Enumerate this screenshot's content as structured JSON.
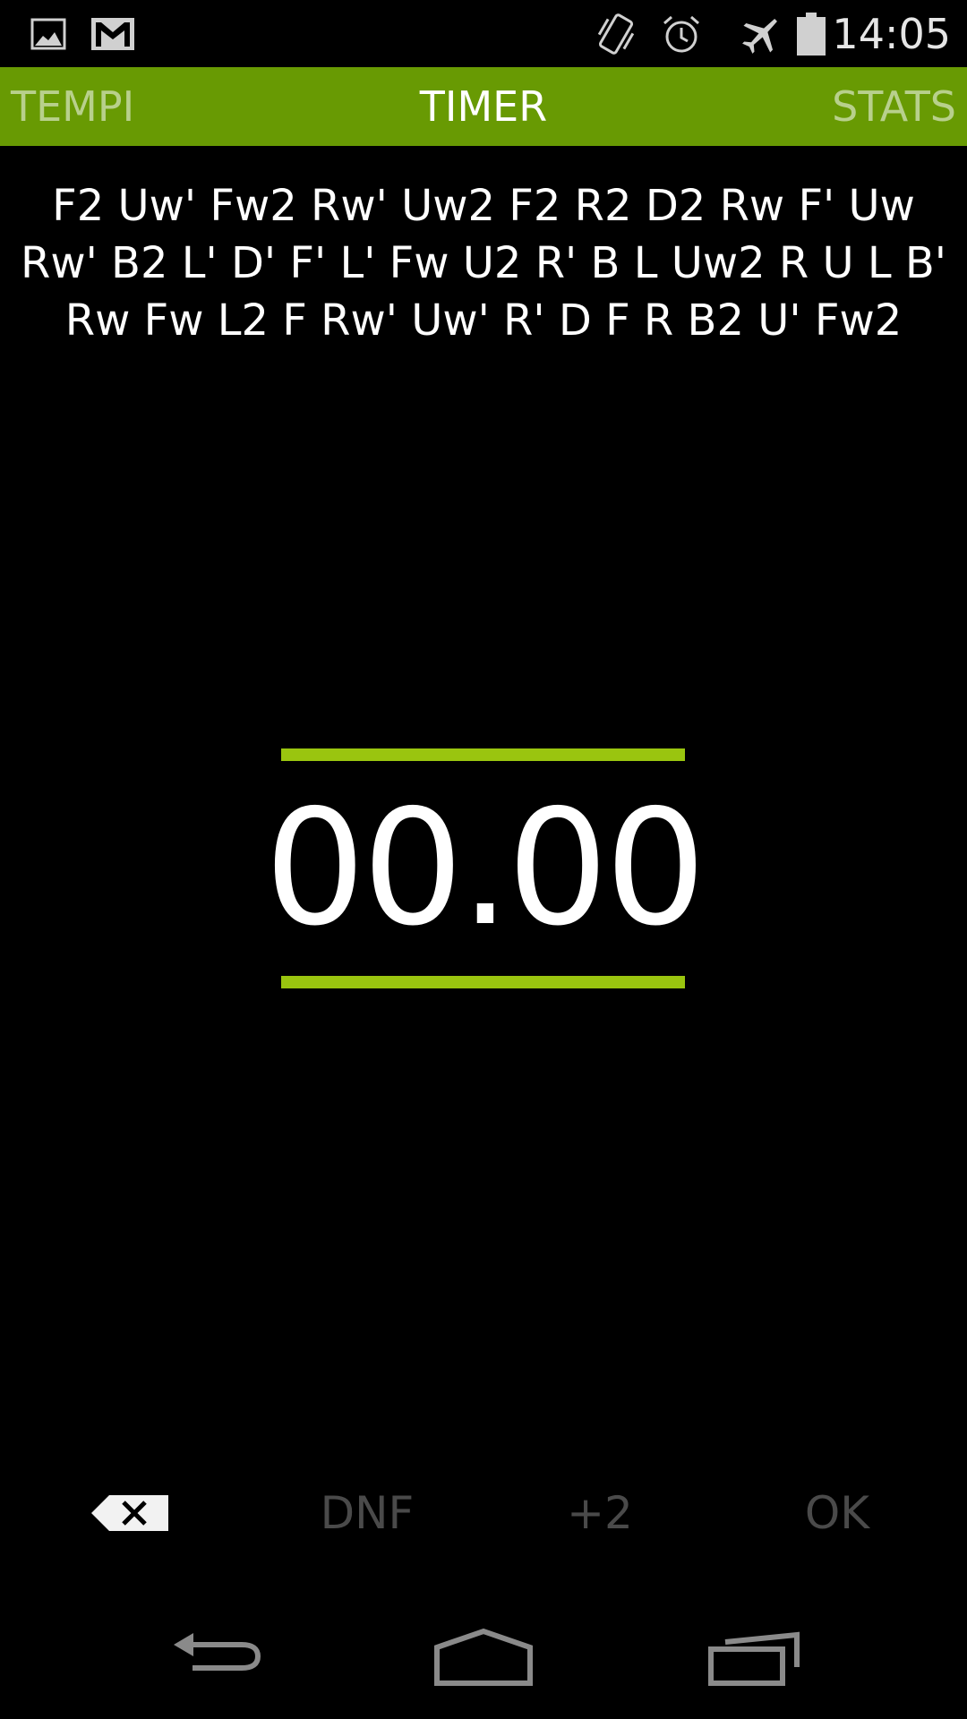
{
  "status_bar": {
    "time": "14:05",
    "left_icons": [
      "gallery-icon",
      "gmail-icon"
    ],
    "right_icons": [
      "vibrate-icon",
      "alarm-icon",
      "airplane-mode-icon",
      "battery-icon"
    ]
  },
  "tabs": [
    {
      "label": "TEMPI",
      "selected": false
    },
    {
      "label": "TIMER",
      "selected": true
    },
    {
      "label": "STATS",
      "selected": false
    }
  ],
  "scramble": "F2 Uw' Fw2 Rw' Uw2 F2 R2 D2 Rw F' Uw Rw' B2 L' D' F' L' Fw U2 R' B L Uw2 R U L B' Rw Fw L2 F Rw' Uw' R' D F R B2 U' Fw2",
  "timer": {
    "value": "00.00"
  },
  "actions": {
    "delete_icon": "backspace-icon",
    "dnf_label": "DNF",
    "plus2_label": "+2",
    "ok_label": "OK"
  },
  "nav_bar": {
    "icons": [
      "back-icon",
      "home-icon",
      "recent-apps-icon"
    ]
  },
  "colors": {
    "tab_bar": "#689a03",
    "accent": "#9ac50f",
    "inactive_tab": "#b8d08c",
    "disabled_action": "#4a4a4a"
  }
}
